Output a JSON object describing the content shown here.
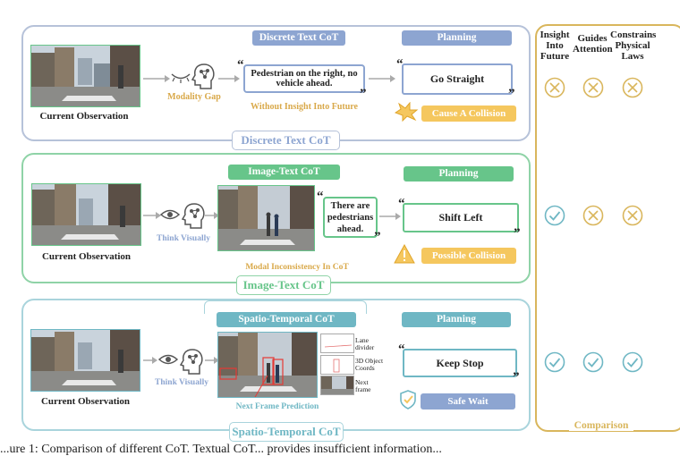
{
  "colors": {
    "blue": "#8da5d1",
    "green": "#67c58a",
    "teal": "#6fb7c4",
    "gold": "#d9b65c",
    "orange": "#f5c75e"
  },
  "row1": {
    "panel_label": "Discrete Text CoT",
    "header": "Discrete Text CoT",
    "observation_caption": "Current Observation",
    "gap_label": "Modality Gap",
    "bubble": "Pedestrian on the right, no vehicle ahead.",
    "note": "Without Insight Into Future",
    "planning_header": "Planning",
    "plan": "Go Straight",
    "outcome": "Cause A Collision"
  },
  "row2": {
    "panel_label": "Image-Text CoT",
    "header": "Image-Text CoT",
    "observation_caption": "Current Observation",
    "think_label": "Think Visually",
    "bubble": "There are pedestrians ahead.",
    "note": "Modal Inconsistency In CoT",
    "planning_header": "Planning",
    "plan": "Shift Left",
    "outcome": "Possible Collision"
  },
  "row3": {
    "panel_label": "Spatio-Temporal CoT",
    "header": "Spatio-Temporal CoT",
    "observation_caption": "Current Observation",
    "think_label": "Think Visually",
    "next_frame_caption": "Next Frame Prediction",
    "mini_labels": [
      "Lane divider",
      "3D Object Coords",
      "Next frame"
    ],
    "planning_header": "Planning",
    "plan": "Keep Stop",
    "outcome": "Safe Wait"
  },
  "comparison": {
    "label": "Comparison",
    "columns": [
      "Insight Into Future",
      "Guides Attention",
      "Constrains Physical Laws"
    ],
    "rows": [
      [
        "no",
        "no",
        "no"
      ],
      [
        "yes",
        "no",
        "no"
      ],
      [
        "yes",
        "yes",
        "yes"
      ]
    ]
  },
  "caption_fragment": "...ure 1: Comparison of different CoT. Textual CoT... provides insufficient information..."
}
